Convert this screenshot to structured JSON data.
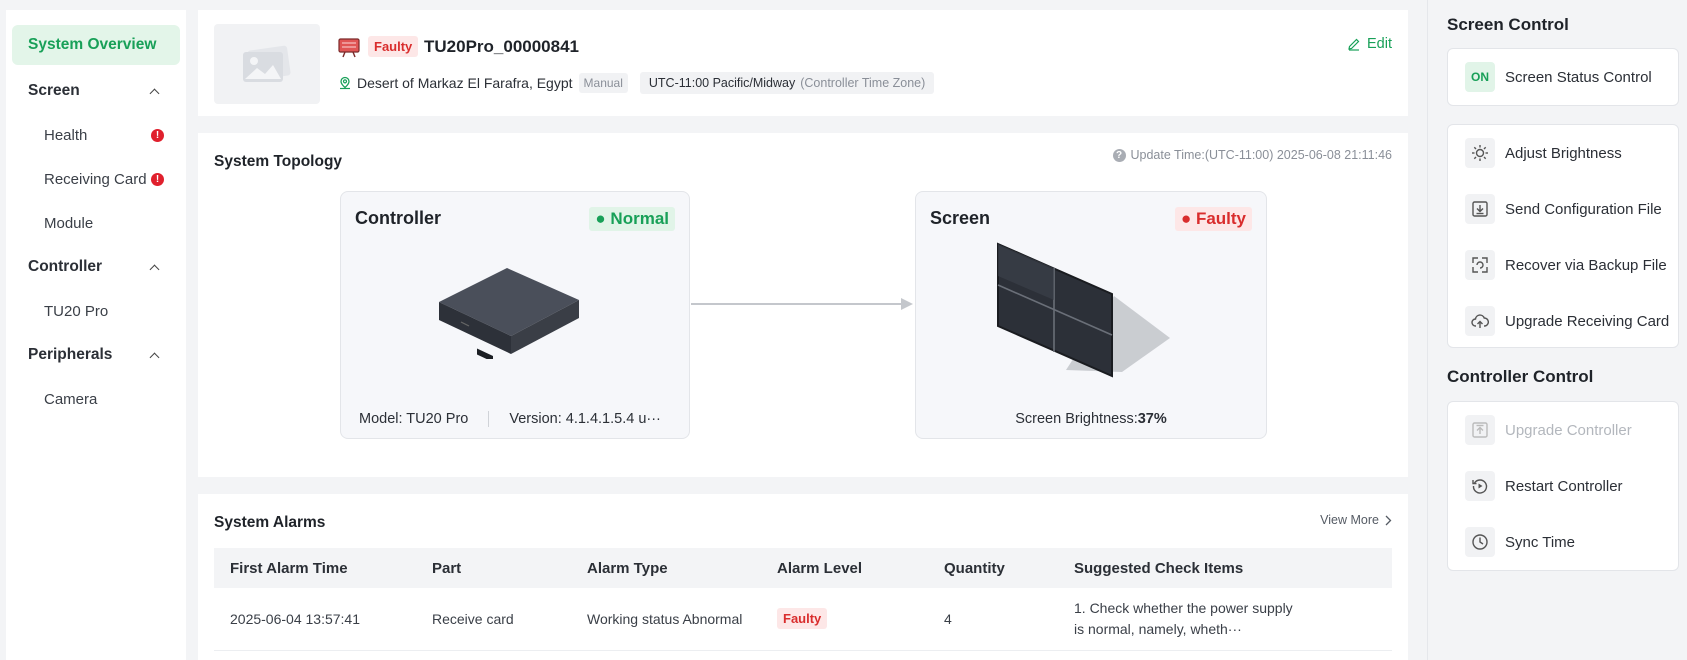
{
  "sidebar": {
    "active": "System Overview",
    "groups": [
      {
        "label": "Screen",
        "items": [
          "Health",
          "Receiving Card",
          "Module"
        ]
      },
      {
        "label": "Controller",
        "items": [
          "TU20 Pro"
        ]
      },
      {
        "label": "Peripherals",
        "items": [
          "Camera"
        ]
      }
    ],
    "alert_glyph": "!"
  },
  "header": {
    "status_badge": "Faulty",
    "device_name": "TU20Pro_00000841",
    "location": "Desert of Markaz El Farafra, Egypt",
    "location_mode": "Manual",
    "timezone": "UTC-11:00 Pacific/Midway",
    "timezone_note": "(Controller Time Zone)",
    "edit_label": "Edit"
  },
  "topology": {
    "title": "System Topology",
    "update_time": "Update Time:(UTC-11:00) 2025-06-08 21:11:46",
    "controller": {
      "title": "Controller",
      "status": "Normal",
      "model": "Model: TU20 Pro",
      "version": "Version: 4.1.4.1.5.4  u···"
    },
    "screen": {
      "title": "Screen",
      "status": "Faulty",
      "brightness_label": "Screen Brightness:",
      "brightness_value": "37%"
    }
  },
  "alarms": {
    "title": "System Alarms",
    "view_more": "View More",
    "columns": [
      "First Alarm Time",
      "Part",
      "Alarm Type",
      "Alarm Level",
      "Quantity",
      "Suggested Check Items"
    ],
    "rows": [
      {
        "time": "2025-06-04 13:57:41",
        "part": "Receive card",
        "type": "Working status Abnormal",
        "level": "Faulty",
        "quantity": "4",
        "suggested": "1. Check whether the power supply is normal, namely, wheth···"
      }
    ]
  },
  "right_panel": {
    "screen_control_title": "Screen Control",
    "on_label": "ON",
    "screen_status_control": "Screen Status Control",
    "screen_actions": [
      "Adjust Brightness",
      "Send Configuration File",
      "Recover via Backup File",
      "Upgrade Receiving Card"
    ],
    "controller_control_title": "Controller Control",
    "controller_actions": [
      "Upgrade Controller",
      "Restart Controller",
      "Sync Time"
    ]
  },
  "colors": {
    "accent_green": "#18a058",
    "fault_red": "#d92d2d",
    "alert_red": "#e0202d"
  }
}
